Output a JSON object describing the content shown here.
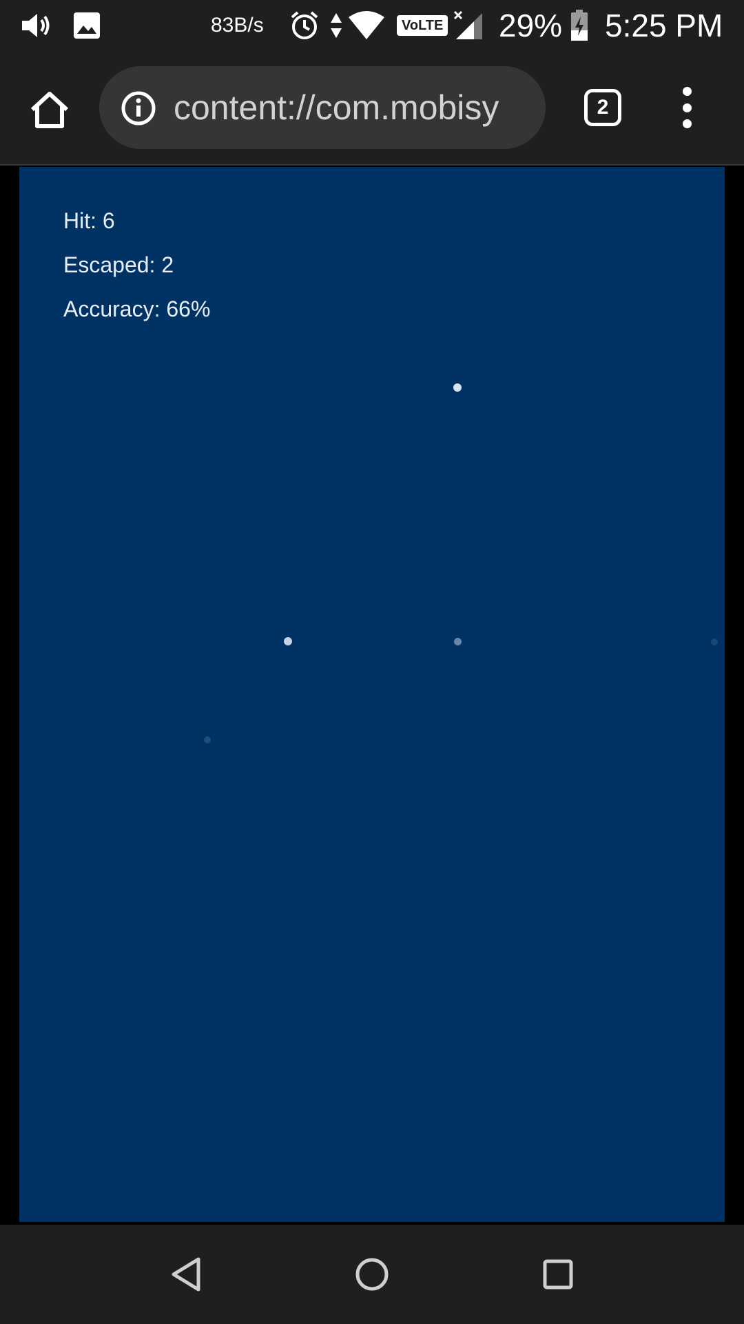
{
  "status_bar": {
    "net_speed": "83B/s",
    "network_badge": "VoLTE",
    "battery": "29%",
    "time": "5:25 PM",
    "icons": [
      "volume-icon",
      "image-icon",
      "alarm-icon",
      "data-arrows-icon",
      "wifi-icon",
      "volte-icon",
      "signal-icon",
      "battery-icon"
    ]
  },
  "browser": {
    "url": "content://com.mobisy",
    "tab_count": "2",
    "icons": [
      "home-icon",
      "info-icon",
      "tabs-icon",
      "more-vert-icon"
    ]
  },
  "game": {
    "background_color": "#003264",
    "hit": "Hit: 6",
    "escaped": "Escaped: 2",
    "accuracy": "Accuracy: 66%"
  },
  "nav_bar": {
    "icons": [
      "back-icon",
      "home-circle-icon",
      "recents-icon"
    ]
  }
}
